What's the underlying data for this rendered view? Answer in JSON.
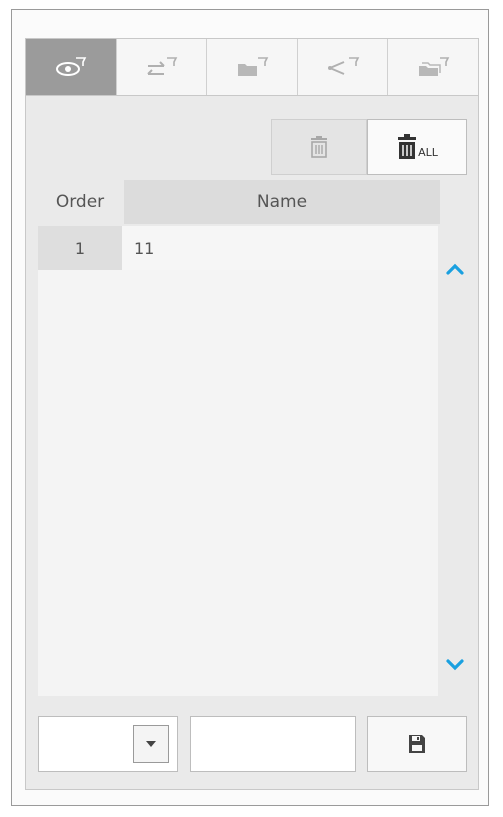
{
  "tabs": [
    {
      "icon": "eye-filter-icon",
      "active": true
    },
    {
      "icon": "swap-filter-icon",
      "active": false
    },
    {
      "icon": "folder-filter-icon",
      "active": false
    },
    {
      "icon": "share-filter-icon",
      "active": false
    },
    {
      "icon": "folders-filter-icon",
      "active": false
    }
  ],
  "toolbar": {
    "delete_icon": "trash-icon",
    "delete_all_icon": "trash-all-icon",
    "delete_all_text": "ALL"
  },
  "table": {
    "headers": {
      "order": "Order",
      "name": "Name"
    },
    "rows": [
      {
        "order": "1",
        "name": "11"
      }
    ]
  },
  "scroll": {
    "up_icon": "chevron-up-icon",
    "down_icon": "chevron-down-icon",
    "accent": "#1aa0e0"
  },
  "footer": {
    "select_value": "",
    "input_value": "",
    "save_icon": "save-icon"
  }
}
